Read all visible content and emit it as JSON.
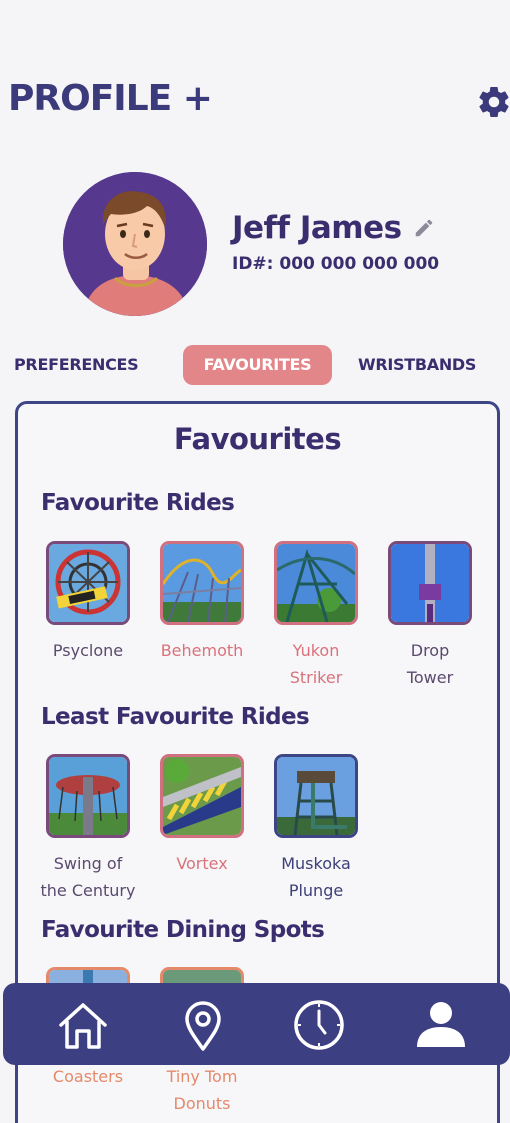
{
  "header": {
    "title": "PROFILE +"
  },
  "profile": {
    "name": "Jeff James",
    "id": "ID#: 000 000 000 000"
  },
  "tabs": [
    "PREFERENCES",
    "FAVOURITES",
    "WRISTBANDS"
  ],
  "panel_title": "Favourites",
  "sections": {
    "fav_rides": {
      "title": "Favourite Rides",
      "items": [
        {
          "line1": "Psyclone",
          "line2": ""
        },
        {
          "line1": "Behemoth",
          "line2": ""
        },
        {
          "line1": "Yukon",
          "line2": "Striker"
        },
        {
          "line1": "Drop",
          "line2": "Tower"
        }
      ]
    },
    "least_rides": {
      "title": "Least Favourite Rides",
      "items": [
        {
          "line1": "Swing of",
          "line2": "the Century"
        },
        {
          "line1": "Vortex",
          "line2": ""
        },
        {
          "line1": "Muskoka",
          "line2": "Plunge"
        }
      ]
    },
    "dining": {
      "title": "Favourite Dining Spots",
      "items": [
        {
          "line1": "Coasters",
          "line2": ""
        },
        {
          "line1": "Tiny Tom",
          "line2": "Donuts"
        }
      ]
    }
  },
  "nav": [
    "home-icon",
    "location-pin-icon",
    "clock-icon",
    "user-icon"
  ],
  "colors": {
    "accent": "#e2868a",
    "navy": "#3c3f82",
    "text": "#3b2e6e"
  }
}
